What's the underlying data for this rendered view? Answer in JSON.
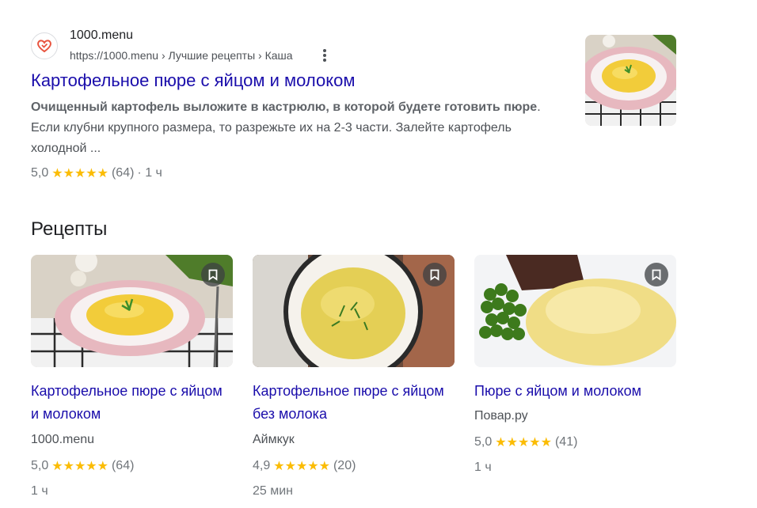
{
  "result": {
    "site_name": "1000.menu",
    "breadcrumb": "https://1000.menu › Лучшие рецепты › Каша",
    "title": "Картофельное пюре с яйцом и молоком",
    "snippet_bold": "Очищенный картофель выложите в кастрюлю, в которой будете готовить пюре",
    "snippet_rest": ". Если клубни крупного размера, то разрежьте их на 2-3 части. Залейте картофель холодной ...",
    "rating": "5,0",
    "stars": "★★★★★",
    "reviews": "(64)",
    "time": "· 1 ч"
  },
  "section_title": "Рецепты",
  "cards": [
    {
      "title": "Картофельное пюре с яйцом и молоком",
      "source": "1000.menu",
      "rating": "5,0",
      "stars": "★★★★★",
      "reviews": "(64)",
      "time": "1 ч"
    },
    {
      "title": "Картофельное пюре с яйцом без молока",
      "source": "Аймкук",
      "rating": "4,9",
      "stars": "★★★★★",
      "reviews": "(20)",
      "time": "25 мин"
    },
    {
      "title": "Пюре с яйцом и молоком",
      "source": "Повар.ру",
      "rating": "5,0",
      "stars": "★★★★★",
      "reviews": "(41)",
      "time": "1 ч"
    }
  ],
  "colors": {
    "link": "#1a0dab",
    "star": "#fbbc04",
    "muted": "#70757a"
  }
}
